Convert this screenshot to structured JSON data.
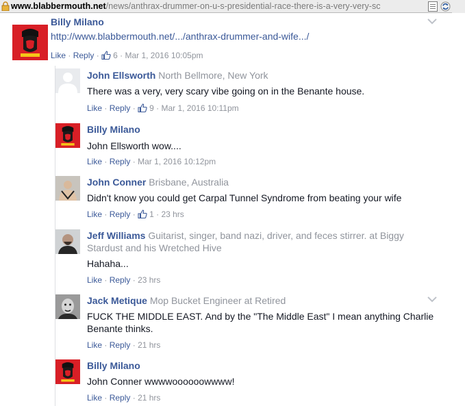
{
  "urlbar": {
    "domain": "www.blabbermouth.net",
    "path": "/news/anthrax-drummer-on-u-s-presidential-race-there-is-a-very-very-sc"
  },
  "colors": {
    "link": "#3b5998",
    "meta": "#90949c",
    "text": "#141823"
  },
  "comments": [
    {
      "name": "Billy Milano",
      "meta": "",
      "body": [
        "http://www.blabbermouth.net/.../anthrax-drummer-and-wife.../"
      ],
      "like": "Like",
      "reply": "Reply",
      "likes": "6",
      "time": "Mar 1, 2016 10:05pm",
      "avatar": "billy-milano-avatar"
    },
    {
      "name": "John Ellsworth",
      "meta": "North Bellmore, New York",
      "body": [
        "There was a very, very scary vibe going on in the Benante house."
      ],
      "like": "Like",
      "reply": "Reply",
      "likes": "9",
      "time": "Mar 1, 2016 10:11pm",
      "avatar": "default-avatar"
    },
    {
      "name": "Billy Milano",
      "meta": "",
      "body": [
        "John Ellsworth wow...."
      ],
      "like": "Like",
      "reply": "Reply",
      "likes": "",
      "time": "Mar 1, 2016 10:12pm",
      "avatar": "billy-milano-avatar"
    },
    {
      "name": "John Conner",
      "meta": "Brisbane, Australia",
      "body": [
        "Didn't know you could get Carpal Tunnel Syndrome from beating your wife"
      ],
      "like": "Like",
      "reply": "Reply",
      "likes": "1",
      "time": "23 hrs",
      "avatar": "john-conner-avatar"
    },
    {
      "name": "Jeff Williams",
      "meta_line1": "Guitarist, singer, band nazi, driver, and feces stirrer. at Biggy",
      "meta_line2": "Stardust and his Wretched Hive",
      "body": [
        "Hahaha..."
      ],
      "like": "Like",
      "reply": "Reply",
      "likes": "",
      "time": "23 hrs",
      "avatar": "jeff-williams-avatar"
    },
    {
      "name": "Jack Metique",
      "meta": "Mop Bucket Engineer at Retired",
      "body": [
        "FUCK THE MIDDLE EAST. And by the \"The Middle East\" I mean anything Charlie",
        "Benante thinks."
      ],
      "like": "Like",
      "reply": "Reply",
      "likes": "",
      "time": "21 hrs",
      "avatar": "jack-metique-avatar"
    },
    {
      "name": "Billy Milano",
      "meta": "",
      "body": [
        "John Conner wwwwoooooowwww!"
      ],
      "like": "Like",
      "reply": "Reply",
      "likes": "",
      "time": "21 hrs",
      "avatar": "billy-milano-avatar"
    }
  ],
  "sep": "·"
}
